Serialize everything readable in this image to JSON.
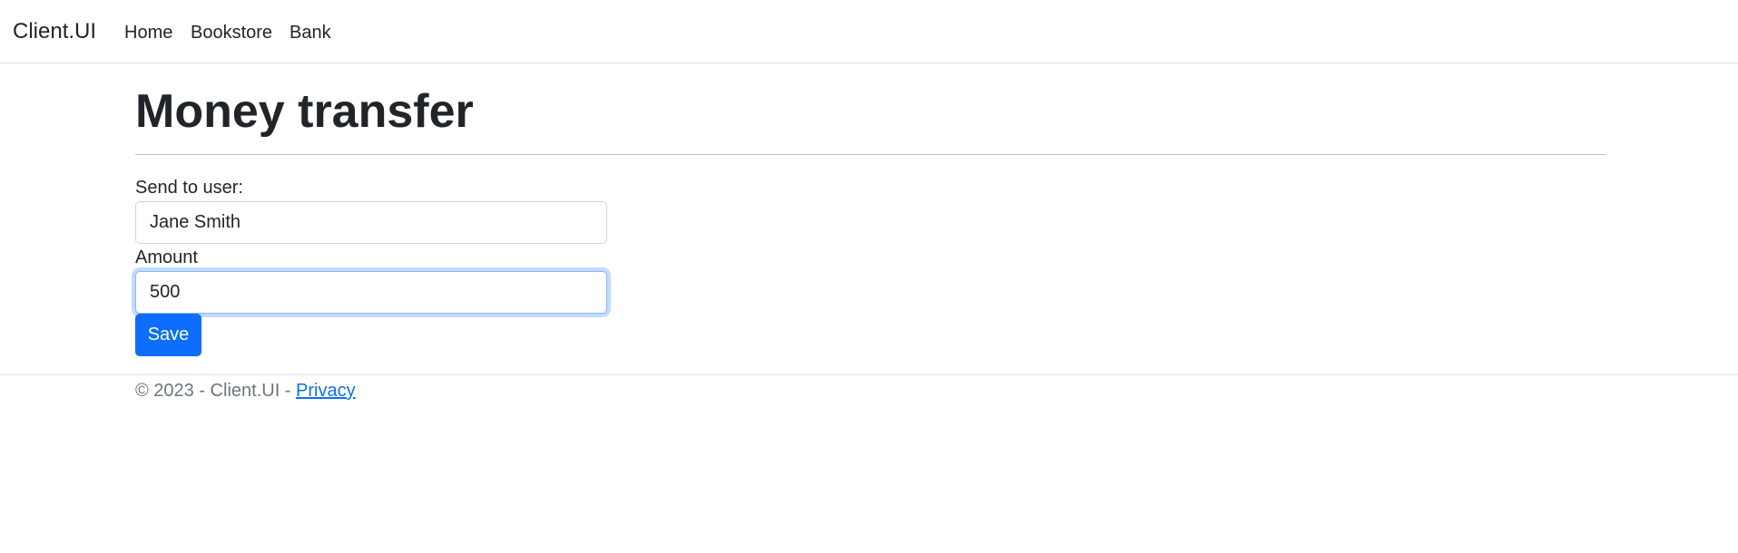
{
  "navbar": {
    "brand": "Client.UI",
    "links": [
      "Home",
      "Bookstore",
      "Bank"
    ]
  },
  "main": {
    "title": "Money transfer",
    "form": {
      "send_to_label": "Send to user:",
      "send_to_value": "Jane Smith",
      "amount_label": "Amount",
      "amount_value": "500",
      "save_label": "Save"
    }
  },
  "footer": {
    "copyright": "© 2023 - Client.UI - ",
    "privacy_link": "Privacy"
  },
  "colors": {
    "primary": "#0d6efd",
    "text": "#212529",
    "muted": "#6c757d",
    "focus_ring": "#86b7fe"
  }
}
